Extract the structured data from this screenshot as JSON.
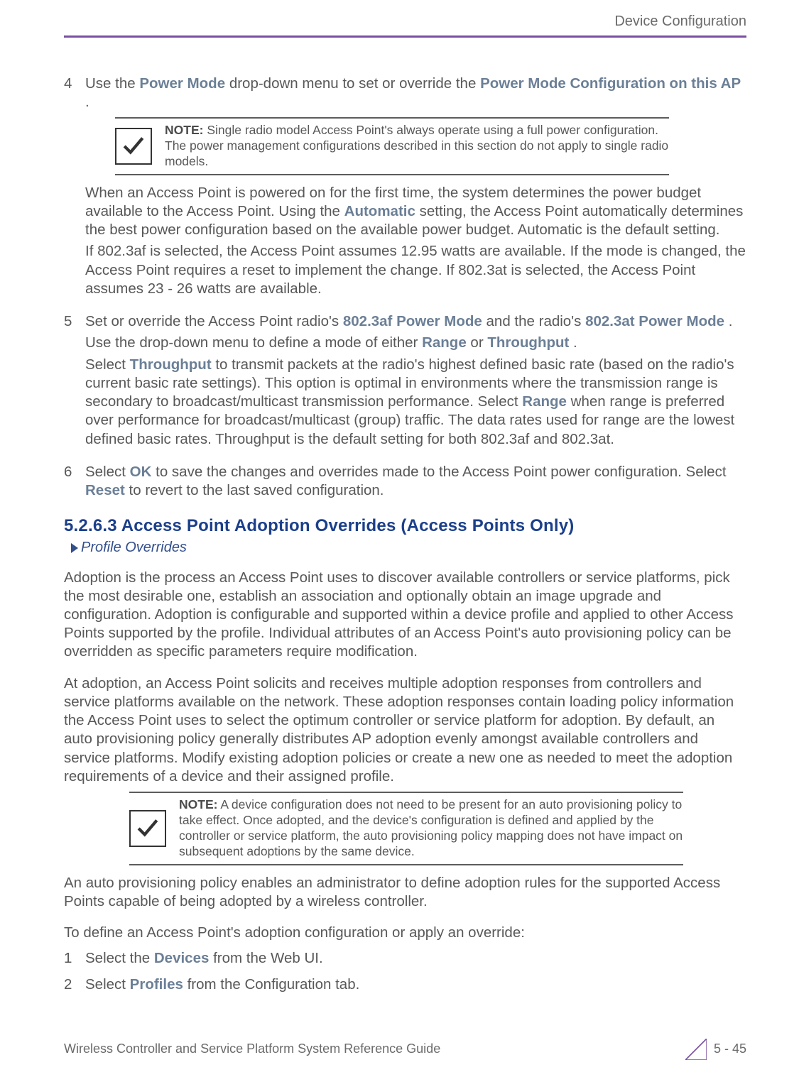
{
  "header": {
    "right_title": "Device Configuration"
  },
  "items4": {
    "num": "4",
    "line1_a": "Use the ",
    "line1_bold1": "Power Mode",
    "line1_b": " drop-down menu to set or override the ",
    "line1_bold2": "Power Mode Configuration on this AP",
    "line1_c": ".",
    "note": {
      "label": "NOTE:",
      "text": "  Single radio model Access Point's always operate using a full power configuration. The power management configurations described in this section do not apply to single radio models."
    },
    "p1_a": "When an Access Point is powered on for the first time, the system determines the power budget available to the Access Point. Using the ",
    "p1_bold": "Automatic",
    "p1_b": " setting, the Access Point automatically determines the best power configuration based on the available power budget. Automatic is the default setting.",
    "p2": "If 802.3af is selected, the Access Point assumes 12.95 watts are available. If the mode is changed, the Access Point requires a reset to implement the change. If 802.3at is selected, the Access Point assumes 23 - 26 watts are available."
  },
  "items5": {
    "num": "5",
    "line1_a": "Set or override the Access Point radio's ",
    "line1_bold1": "802.3af Power Mode",
    "line1_b": " and the radio's ",
    "line1_bold2": "802.3at Power Mode",
    "line1_c": ".",
    "p2_a": "Use the drop-down menu to define a mode of either ",
    "p2_bold1": "Range",
    "p2_b": " or ",
    "p2_bold2": "Throughput",
    "p2_c": ".",
    "p3_a": "Select ",
    "p3_bold1": "Throughput",
    "p3_b": " to transmit packets at the radio's highest defined basic rate (based on the radio's current basic rate settings). This option is optimal in environments where the transmission range is secondary to broadcast/multicast transmission performance. Select ",
    "p3_bold2": "Range",
    "p3_c": " when range is preferred over performance for broadcast/multicast (group) traffic. The data rates used for range are the lowest defined basic rates. Throughput is the default setting for both 802.3af and 802.3at."
  },
  "items6": {
    "num": "6",
    "line1_a": "Select ",
    "line1_bold1": "OK",
    "line1_b": " to save the changes and overrides made to the Access Point power configuration. Select ",
    "line1_bold2": "Reset",
    "line1_c": " to revert to the last saved configuration."
  },
  "section": {
    "title": "5.2.6.3 Access Point Adoption Overrides (Access Points Only)",
    "breadcrumb": "Profile Overrides"
  },
  "body": {
    "p1": "Adoption is the process an Access Point uses to discover available controllers or service platforms, pick the most desirable one, establish an association and optionally obtain an image upgrade and configuration. Adoption is configurable and supported within a device profile and applied to other Access Points supported by the profile. Individual attributes of an Access Point's auto provisioning policy can be overridden as specific parameters require modification.",
    "p2": "At adoption, an Access Point solicits and receives multiple adoption responses from controllers and service platforms available on the network. These adoption responses contain loading policy information the Access Point uses to select the optimum controller or service platform for adoption. By default, an auto provisioning policy generally distributes AP adoption evenly amongst available controllers and service platforms. Modify existing adoption policies or create a new one as needed to meet the adoption requirements of a device and their assigned profile.",
    "note": {
      "label": "NOTE:",
      "text": " A device configuration does not need to be present for an auto provisioning policy to take effect. Once adopted, and the device's configuration is defined and applied by the controller or service platform, the auto provisioning policy mapping does not have impact on subsequent adoptions by the same device."
    },
    "p3": "An auto provisioning policy enables an administrator to define adoption rules for the supported Access Points capable of being adopted by a wireless controller.",
    "p4": "To define an Access Point's adoption configuration or apply an override:"
  },
  "steps": {
    "s1": {
      "num": "1",
      "a": "Select the ",
      "bold": "Devices",
      "b": " from the Web UI."
    },
    "s2": {
      "num": "2",
      "a": "Select ",
      "bold": "Profiles",
      "b": " from the Configuration tab."
    }
  },
  "footer": {
    "left": "Wireless Controller and Service Platform System Reference Guide",
    "right": "5 - 45"
  }
}
